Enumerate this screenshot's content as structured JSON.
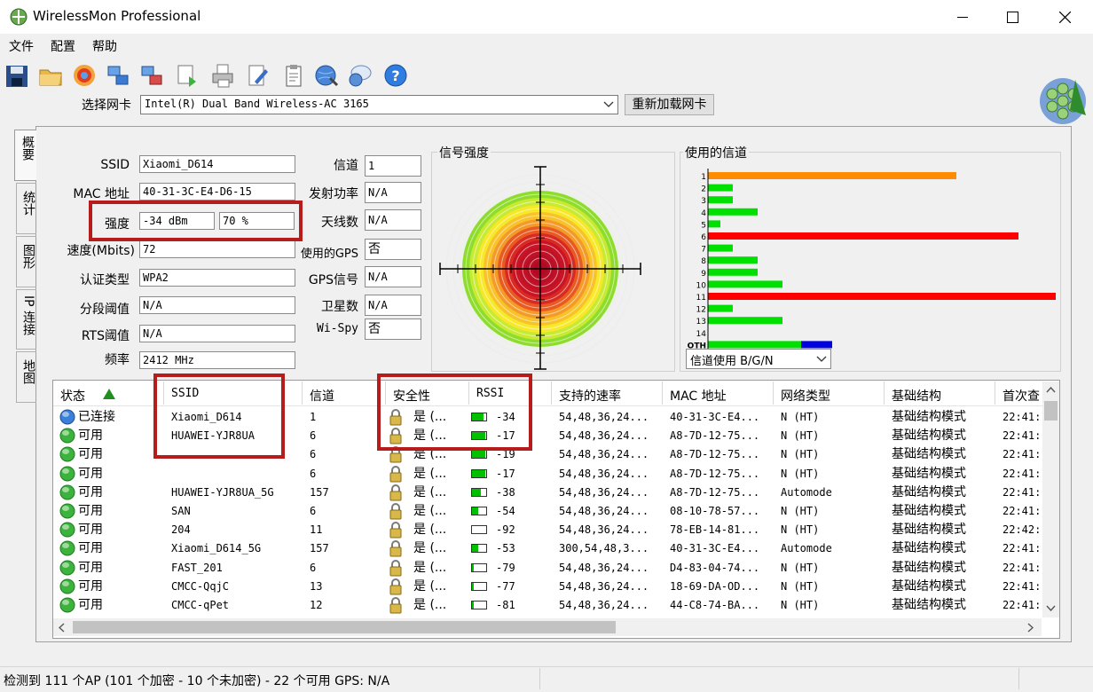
{
  "window": {
    "title": "WirelessMon Professional"
  },
  "menu": [
    "文件",
    "配置",
    "帮助"
  ],
  "toolbar": {
    "adapter_label": "选择网卡",
    "adapter_value": "Intel(R) Dual Band Wireless-AC 3165",
    "reload_label": "重新加载网卡"
  },
  "tabs": [
    "概要",
    "统计",
    "图形",
    "IP 连接",
    "地图"
  ],
  "summary": {
    "ssid_label": "SSID",
    "ssid": "Xiaomi_D614",
    "mac_label": "MAC 地址",
    "mac": "40-31-3C-E4-D6-15",
    "strength_label": "强度",
    "strength_dbm": "-34 dBm",
    "strength_pct": "70 %",
    "speed_label": "速度(Mbits)",
    "speed": "72",
    "auth_label": "认证类型",
    "auth": "WPA2",
    "frag_label": "分段阈值",
    "frag": "N/A",
    "rts_label": "RTS阈值",
    "rts": "N/A",
    "freq_label": "频率",
    "freq": "2412 MHz",
    "channel_label": "信道",
    "channel": "1",
    "txpower_label": "发射功率",
    "txpower": "N/A",
    "antenna_label": "天线数",
    "antenna": "N/A",
    "gps_label": "使用的GPS",
    "gps": "否",
    "gpssig_label": "GPS信号",
    "gpssig": "N/A",
    "sat_label": "卫星数",
    "sat": "N/A",
    "wispy_label": "Wi-Spy",
    "wispy": "否"
  },
  "signal": {
    "title": "信号强度"
  },
  "channels": {
    "title": "使用的信道",
    "select_value": "信道使用 B/G/N",
    "colors": {
      "orange": "#ff8c00",
      "green": "#00e000",
      "red": "#ff0000",
      "blue": "#0000e0"
    },
    "chart_data": {
      "type": "bar",
      "categories": [
        "1",
        "2",
        "3",
        "4",
        "5",
        "6",
        "7",
        "8",
        "9",
        "10",
        "11",
        "12",
        "13",
        "14",
        "OTH"
      ],
      "values": [
        20,
        2,
        2,
        4,
        1,
        25,
        2,
        4,
        4,
        6,
        28,
        2,
        6,
        0,
        10
      ],
      "bar_colors": [
        "orange",
        "green",
        "green",
        "green",
        "green",
        "red",
        "green",
        "green",
        "green",
        "green",
        "red",
        "green",
        "green",
        "green",
        "green+blue"
      ]
    }
  },
  "table": {
    "columns": [
      "状态",
      "SSID",
      "信道",
      "安全性",
      "RSSI",
      "支持的速率",
      "MAC 地址",
      "网络类型",
      "基础结构",
      "首次查"
    ],
    "rows": [
      {
        "status": "已连接",
        "connected": true,
        "ssid": "Xiaomi_D614",
        "channel": "1",
        "security": "是 (...",
        "rssi": "-34",
        "rssi_level": 0.8,
        "rates": "54,48,36,24...",
        "mac": "40-31-3C-E4...",
        "nettype": "N (HT)",
        "infra": "基础结构模式",
        "first": "22:41:"
      },
      {
        "status": "可用",
        "connected": false,
        "ssid": "HUAWEI-YJR8UA",
        "channel": "6",
        "security": "是 (...",
        "rssi": "-17",
        "rssi_level": 0.95,
        "rates": "54,48,36,24...",
        "mac": "A8-7D-12-75...",
        "nettype": "N (HT)",
        "infra": "基础结构模式",
        "first": "22:41:"
      },
      {
        "status": "可用",
        "connected": false,
        "ssid": "",
        "channel": "6",
        "security": "是 (...",
        "rssi": "-19",
        "rssi_level": 0.95,
        "rates": "54,48,36,24...",
        "mac": "A8-7D-12-75...",
        "nettype": "N (HT)",
        "infra": "基础结构模式",
        "first": "22:41:"
      },
      {
        "status": "可用",
        "connected": false,
        "ssid": "",
        "channel": "6",
        "security": "是 (...",
        "rssi": "-17",
        "rssi_level": 0.95,
        "rates": "54,48,36,24...",
        "mac": "A8-7D-12-75...",
        "nettype": "N (HT)",
        "infra": "基础结构模式",
        "first": "22:41:"
      },
      {
        "status": "可用",
        "connected": false,
        "ssid": "HUAWEI-YJR8UA_5G",
        "channel": "157",
        "security": "是 (...",
        "rssi": "-38",
        "rssi_level": 0.65,
        "rates": "54,48,36,24...",
        "mac": "A8-7D-12-75...",
        "nettype": "Automode",
        "infra": "基础结构模式",
        "first": "22:41:"
      },
      {
        "status": "可用",
        "connected": false,
        "ssid": "SAN",
        "channel": "6",
        "security": "是 (...",
        "rssi": "-54",
        "rssi_level": 0.45,
        "rates": "54,48,36,24...",
        "mac": "08-10-78-57...",
        "nettype": "N (HT)",
        "infra": "基础结构模式",
        "first": "22:41:"
      },
      {
        "status": "可用",
        "connected": false,
        "ssid": "204",
        "channel": "11",
        "security": "是 (...",
        "rssi": "-92",
        "rssi_level": 0.0,
        "rates": "54,48,36,24...",
        "mac": "78-EB-14-81...",
        "nettype": "N (HT)",
        "infra": "基础结构模式",
        "first": "22:42:"
      },
      {
        "status": "可用",
        "connected": false,
        "ssid": "Xiaomi_D614_5G",
        "channel": "157",
        "security": "是 (...",
        "rssi": "-53",
        "rssi_level": 0.45,
        "rates": "300,54,48,3...",
        "mac": "40-31-3C-E4...",
        "nettype": "Automode",
        "infra": "基础结构模式",
        "first": "22:41:"
      },
      {
        "status": "可用",
        "connected": false,
        "ssid": "FAST_201",
        "channel": "6",
        "security": "是 (...",
        "rssi": "-79",
        "rssi_level": 0.1,
        "rates": "54,48,36,24...",
        "mac": "D4-83-04-74...",
        "nettype": "N (HT)",
        "infra": "基础结构模式",
        "first": "22:41:"
      },
      {
        "status": "可用",
        "connected": false,
        "ssid": "CMCC-QqjC",
        "channel": "13",
        "security": "是 (...",
        "rssi": "-77",
        "rssi_level": 0.1,
        "rates": "54,48,36,24...",
        "mac": "18-69-DA-OD...",
        "nettype": "N (HT)",
        "infra": "基础结构模式",
        "first": "22:41:"
      },
      {
        "status": "可用",
        "connected": false,
        "ssid": "CMCC-qPet",
        "channel": "12",
        "security": "是 (...",
        "rssi": "-81",
        "rssi_level": 0.1,
        "rates": "54,48,36,24...",
        "mac": "44-C8-74-BA...",
        "nettype": "N (HT)",
        "infra": "基础结构模式",
        "first": "22:41:"
      }
    ]
  },
  "status_bar": {
    "text": "检测到 111 个AP (101 个加密 - 10 个未加密) - 22 个可用 GPS: N/A"
  }
}
